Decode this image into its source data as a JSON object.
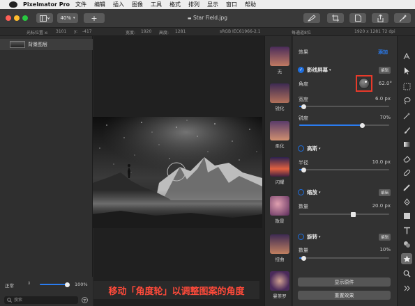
{
  "menubar": {
    "app_name": "Pixelmator Pro",
    "items": [
      "文件",
      "编辑",
      "插入",
      "图像",
      "工具",
      "格式",
      "排列",
      "显示",
      "窗口",
      "帮助"
    ]
  },
  "toolbar": {
    "zoom_value": "40%",
    "add_label": "+",
    "document_title": "Star Field.jpg"
  },
  "infobar": {
    "cursor_label": "光标位置 x:",
    "cursor_x": "3101",
    "y_label": "y:",
    "cursor_y": "-417",
    "width_label": "宽度:",
    "width_value": "1920",
    "height_label": "高度:",
    "height_value": "1281",
    "color_profile": "sRGB IEC61966-2.1",
    "bit_depth": "每通道8位",
    "dimensions": "1920 x 1281 72 dpi"
  },
  "layers": {
    "items": [
      {
        "label": "背景图层"
      }
    ]
  },
  "bottom_bar": {
    "blend_mode": "正常",
    "opacity": "100%",
    "search_placeholder": "搜索"
  },
  "effects_browser": {
    "items": [
      {
        "label": "无"
      },
      {
        "label": "锐化"
      },
      {
        "label": "柔化"
      },
      {
        "label": "闪耀"
      },
      {
        "label": "散景"
      },
      {
        "label": "扭曲"
      },
      {
        "label": "曼荼罗"
      }
    ]
  },
  "effects_panel": {
    "header_label": "效果",
    "add_label": "添加",
    "halftone": {
      "title": "影线屏幕",
      "edit_label": "编辑",
      "angle_label": "角度",
      "angle_value": "62.0°",
      "width_label": "宽度",
      "width_value": "6.0 px",
      "width_fraction": 0.05,
      "sharpness_label": "锐度",
      "sharpness_value": "70%",
      "sharpness_fraction": 0.7
    },
    "highpass": {
      "title": "高斯",
      "radius_label": "半径",
      "radius_value": "10.0 px",
      "radius_fraction": 0.05
    },
    "zoom": {
      "title": "缩放",
      "edit_label": "编辑",
      "amount_label": "数量",
      "amount_value": "20.0 px",
      "amount_fraction": 0.6
    },
    "twirl": {
      "title": "旋转",
      "edit_label": "编辑",
      "amount_label": "数量",
      "amount_value": "10%",
      "amount_fraction": 0.05
    },
    "show_original_label": "显示原件",
    "reset_label": "重置效果"
  },
  "caption": {
    "text": "移动「角度轮」以调整图案的角度"
  },
  "colors": {
    "accent": "#2a7cf0",
    "highlight_box": "#e83a2a",
    "caption": "#ff4a3a"
  }
}
